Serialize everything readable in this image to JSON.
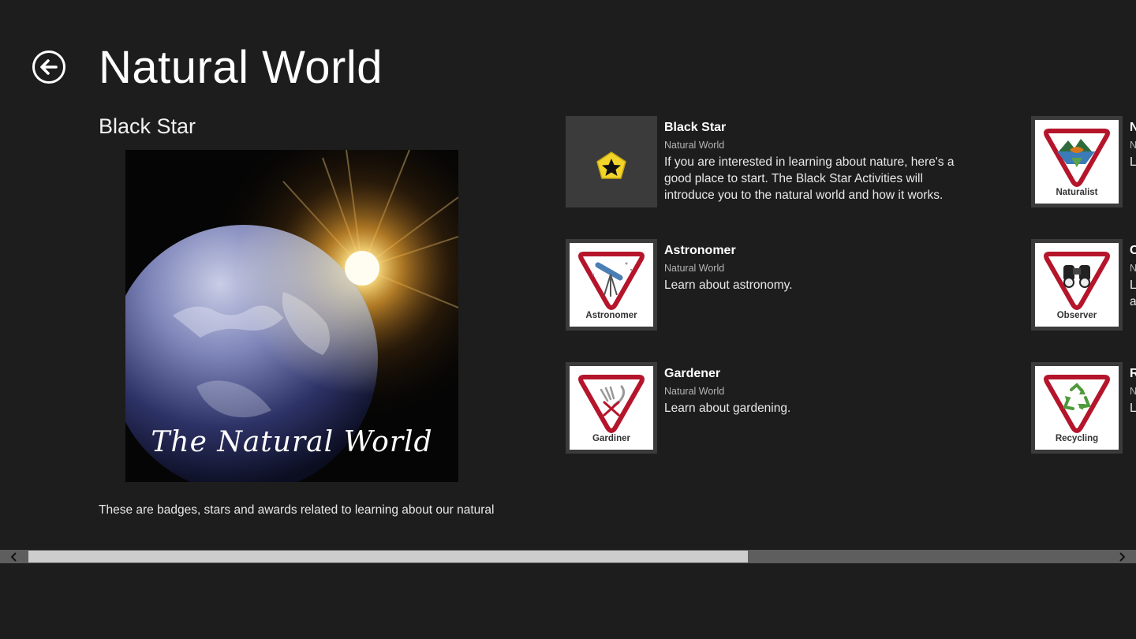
{
  "header": {
    "title": "Natural World",
    "back_icon": "back-arrow-icon"
  },
  "featured": {
    "title": "Black Star",
    "image_caption": "The Natural World",
    "description": "These are badges, stars and awards related to learning about our natural"
  },
  "items": [
    {
      "title": "Black Star",
      "category": "Natural World",
      "description": "If you are interested in learning about nature, here's a good place to start. The Black Star Activities will introduce you to the natural world and how it works.",
      "badge_label": "",
      "icon": "black-star-icon"
    },
    {
      "title": "Astronomer",
      "category": "Natural World",
      "description": "Learn about astronomy.",
      "badge_label": "Astronomer",
      "icon": "telescope-icon"
    },
    {
      "title": "Gardener",
      "category": "Natural World",
      "description": "Learn about gardening.",
      "badge_label": "Gardiner",
      "icon": "garden-tools-icon"
    }
  ],
  "right_items": [
    {
      "title": "N",
      "category": "N",
      "description": "L",
      "badge_label": "Naturalist",
      "icon": "landscape-icon"
    },
    {
      "title": "C",
      "category": "N",
      "description": "L a",
      "badge_label": "Observer",
      "icon": "binoculars-icon"
    },
    {
      "title": "R",
      "category": "N",
      "description": "L",
      "badge_label": "Recycling",
      "icon": "recycle-icon"
    }
  ],
  "colors": {
    "background": "#1d1d1d",
    "badge_red": "#b5152b",
    "star_yellow": "#f2d52a",
    "scroll_track": "#5e5e5e",
    "scroll_thumb": "#cdcdcd"
  }
}
